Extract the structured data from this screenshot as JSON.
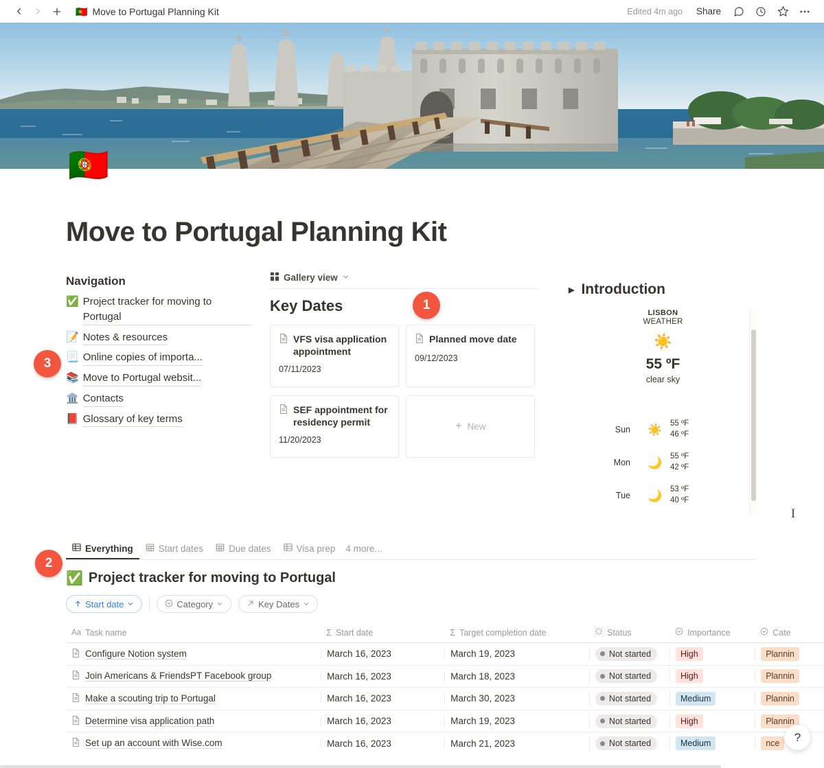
{
  "topbar": {
    "back_icon": "chevron-left-icon",
    "forward_icon": "chevron-right-icon",
    "new_icon": "plus-icon",
    "breadcrumb_emoji": "🇵🇹",
    "breadcrumb_title": "Move to Portugal Planning Kit",
    "edited_text": "Edited 4m ago",
    "share_label": "Share",
    "comment_icon": "comment-icon",
    "history_icon": "clock-icon",
    "favorite_icon": "star-icon",
    "more_icon": "ellipsis-icon"
  },
  "page": {
    "icon": "🇵🇹",
    "title": "Move to Portugal Planning Kit",
    "cover_alt": "Belem Tower Lisbon pier"
  },
  "navigation": {
    "heading": "Navigation",
    "items": [
      {
        "emoji": "✅",
        "label": "Project tracker for moving to Portugal"
      },
      {
        "emoji": "📝",
        "label": "Notes & resources"
      },
      {
        "emoji": "📃",
        "label": "Online copies of importa..."
      },
      {
        "emoji": "📚",
        "label": "Move to Portugal websit..."
      },
      {
        "emoji": "🏛️",
        "label": "Contacts"
      },
      {
        "emoji": "📕",
        "label": "Glossary of key terms"
      }
    ]
  },
  "gallery": {
    "view_label": "Gallery view",
    "view_icon": "gallery-grid-icon",
    "chevron_icon": "chevron-down-icon",
    "title": "Key Dates",
    "cards": [
      {
        "icon": "page-icon",
        "title": "VFS visa application appointment",
        "date": "07/11/2023"
      },
      {
        "icon": "page-icon",
        "title": "Planned move date",
        "date": "09/12/2023"
      },
      {
        "icon": "page-icon",
        "title": "SEF appointment for residency permit",
        "date": "11/20/2023"
      }
    ],
    "new_label": "New",
    "new_icon": "plus-icon"
  },
  "introduction": {
    "toggle_icon": "triangle-right-icon",
    "heading": "Introduction"
  },
  "weather": {
    "city": "LISBON",
    "subtitle": "WEATHER",
    "current_icon": "☀️",
    "current_temp": "55 ºF",
    "current_desc": "clear sky",
    "forecast": [
      {
        "day": "Sun",
        "icon": "☀️",
        "high": "55 ºF",
        "low": "46 ºF"
      },
      {
        "day": "Mon",
        "icon": "🌙",
        "high": "55 ºF",
        "low": "42 ºF"
      },
      {
        "day": "Tue",
        "icon": "🌙",
        "high": "53 ºF",
        "low": "40 ºF"
      }
    ]
  },
  "database": {
    "tabs": [
      {
        "label": "Everything",
        "icon": "table-icon",
        "active": true
      },
      {
        "label": "Start dates",
        "icon": "calendar-icon",
        "active": false
      },
      {
        "label": "Due dates",
        "icon": "calendar-icon",
        "active": false
      },
      {
        "label": "Visa prep",
        "icon": "table-icon",
        "active": false
      }
    ],
    "more_tabs_label": "4 more...",
    "title_emoji": "✅",
    "title": "Project tracker for moving to Portugal",
    "filters": [
      {
        "label": "Start date",
        "icon": "arrow-up-icon",
        "type": "sort"
      },
      {
        "label": "Category",
        "icon": "select-icon",
        "type": "filter"
      },
      {
        "label": "Key Dates",
        "icon": "relation-icon",
        "type": "filter"
      }
    ],
    "columns": [
      {
        "label": "Task name",
        "icon": "Aa"
      },
      {
        "label": "Start date",
        "icon": "Σ"
      },
      {
        "label": "Target completion date",
        "icon": "Σ"
      },
      {
        "label": "Status",
        "icon": "status-icon"
      },
      {
        "label": "Importance",
        "icon": "select-icon"
      },
      {
        "label": "Cate",
        "icon": "select-icon"
      }
    ],
    "rows": [
      {
        "task": "Configure Notion system",
        "start": "March 16, 2023",
        "target": "March 19, 2023",
        "status": "Not started",
        "importance": "High",
        "importance_class": "high",
        "category": "Plannin",
        "category_class": "planning"
      },
      {
        "task": "Join Americans & FriendsPT Facebook group",
        "start": "March 16, 2023",
        "target": "March 18, 2023",
        "status": "Not started",
        "importance": "High",
        "importance_class": "high",
        "category": "Plannin",
        "category_class": "planning"
      },
      {
        "task": "Make a scouting trip to Portugal",
        "start": "March 16, 2023",
        "target": "March 30, 2023",
        "status": "Not started",
        "importance": "Medium",
        "importance_class": "medium",
        "category": "Plannin",
        "category_class": "planning"
      },
      {
        "task": "Determine visa application path",
        "start": "March 16, 2023",
        "target": "March 19, 2023",
        "status": "Not started",
        "importance": "High",
        "importance_class": "high",
        "category": "Plannin",
        "category_class": "planning"
      },
      {
        "task": "Set up an account with Wise.com",
        "start": "March 16, 2023",
        "target": "March 21, 2023",
        "status": "Not started",
        "importance": "Medium",
        "importance_class": "medium",
        "category": "nce",
        "category_class": "finance"
      }
    ]
  },
  "help": {
    "label": "?"
  },
  "annotations": [
    {
      "id": "1",
      "number": "1"
    },
    {
      "id": "2",
      "number": "2"
    },
    {
      "id": "3",
      "number": "3"
    }
  ],
  "colors": {
    "badge": "#f4553f",
    "accent_blue": "#2f80ed",
    "text": "#37352f"
  }
}
